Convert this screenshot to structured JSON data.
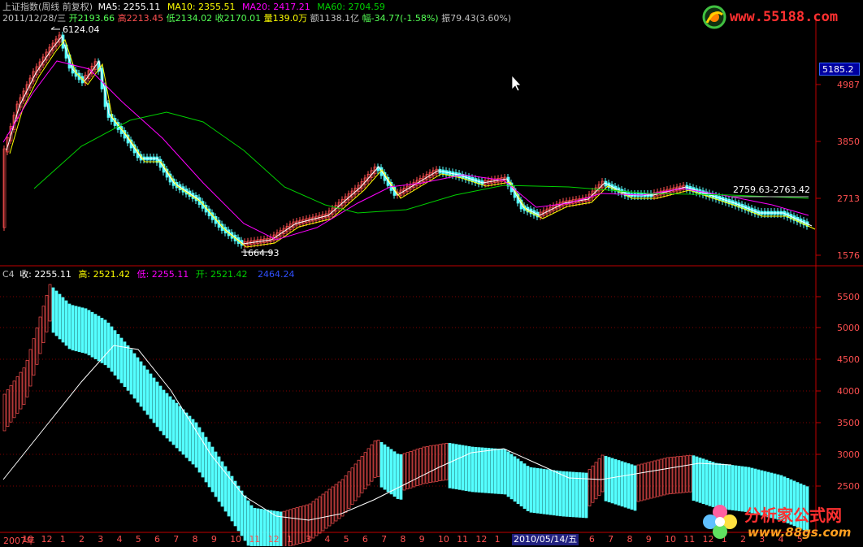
{
  "header": {
    "title": "上证指数(周线 前复权)",
    "ma5": "MA5: 2255.11",
    "ma10": "MA10: 2355.51",
    "ma20": "MA20: 2417.21",
    "ma60": "MA60: 2704.59",
    "date": "2011/12/28/三",
    "open": "开2193.66",
    "high": "高2213.45",
    "low": "低2134.02",
    "close": "收2170.01",
    "volume": "量139.0万",
    "amount": "额1138.1亿",
    "change": "幅-34.77(-1.58%)",
    "amplitude": "振79.43(3.60%)"
  },
  "annotations": {
    "peak": "6124.04",
    "trough": "1664.93",
    "range": "2759.63-2763.42"
  },
  "price_axis": {
    "current": "5185.2",
    "ticks": [
      "4987",
      "3850",
      "2713",
      "1576"
    ]
  },
  "indicator": {
    "name": "C4",
    "close": "收: 2255.11",
    "high": "高: 2521.42",
    "low": "低: 2255.11",
    "open": "开: 2521.42",
    "line": "2464.24",
    "ticks": [
      "5500",
      "5000",
      "4500",
      "4000",
      "3500",
      "3000",
      "2500"
    ]
  },
  "time_axis": {
    "labels": [
      "2007年",
      "10",
      "12",
      "1",
      "2",
      "3",
      "4",
      "5",
      "6",
      "7",
      "8",
      "9",
      "10",
      "11",
      "12",
      "1",
      "3",
      "4",
      "5",
      "6",
      "7",
      "8",
      "9",
      "10",
      "11",
      "12",
      "1",
      "2",
      "3",
      "4",
      "5",
      "6",
      "7",
      "8",
      "9",
      "10",
      "11",
      "12",
      "1",
      "2",
      "3",
      "4",
      "5"
    ],
    "highlight": "2010/05/14/五"
  },
  "logos": {
    "top": "www.55188.com",
    "bottom_title": "分析家公式网",
    "bottom_url": "www.88gs.com"
  },
  "colors": {
    "up": "#ff5050",
    "down": "#54ffff",
    "ma5": "#ffffff",
    "ma10": "#ffff00",
    "ma20": "#ff00ff",
    "ma60": "#00d000",
    "border": "#c00000"
  }
}
